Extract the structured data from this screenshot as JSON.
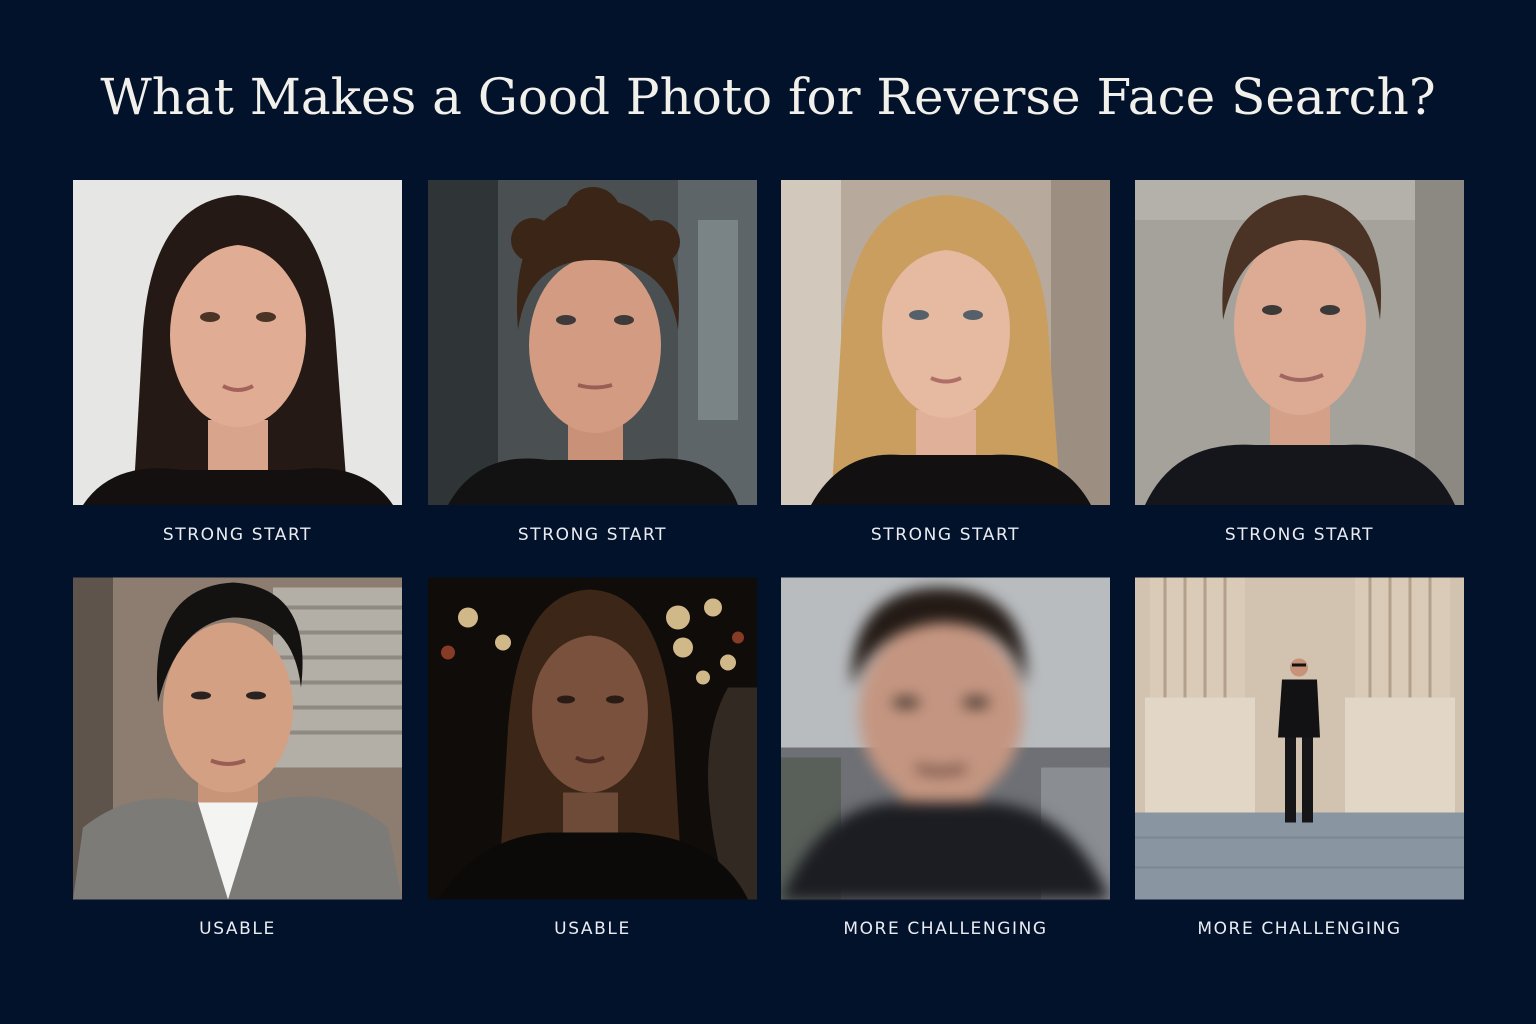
{
  "title": "What Makes a Good Photo for Reverse Face Search?",
  "cards": [
    {
      "label": "STRONG START",
      "subject": "woman with dark hair, plain light background"
    },
    {
      "label": "STRONG START",
      "subject": "man with curly hair, city background"
    },
    {
      "label": "STRONG START",
      "subject": "woman with blonde hair, indoor background"
    },
    {
      "label": "STRONG START",
      "subject": "man in front of stone wall"
    },
    {
      "label": "USABLE",
      "subject": "man in grey blazer, angled face"
    },
    {
      "label": "USABLE",
      "subject": "woman at night with street lights"
    },
    {
      "label": "MORE CHALLENGING",
      "subject": "man with motion-blurred face"
    },
    {
      "label": "MORE CHALLENGING",
      "subject": "distant man with sunglasses between columns"
    }
  ]
}
